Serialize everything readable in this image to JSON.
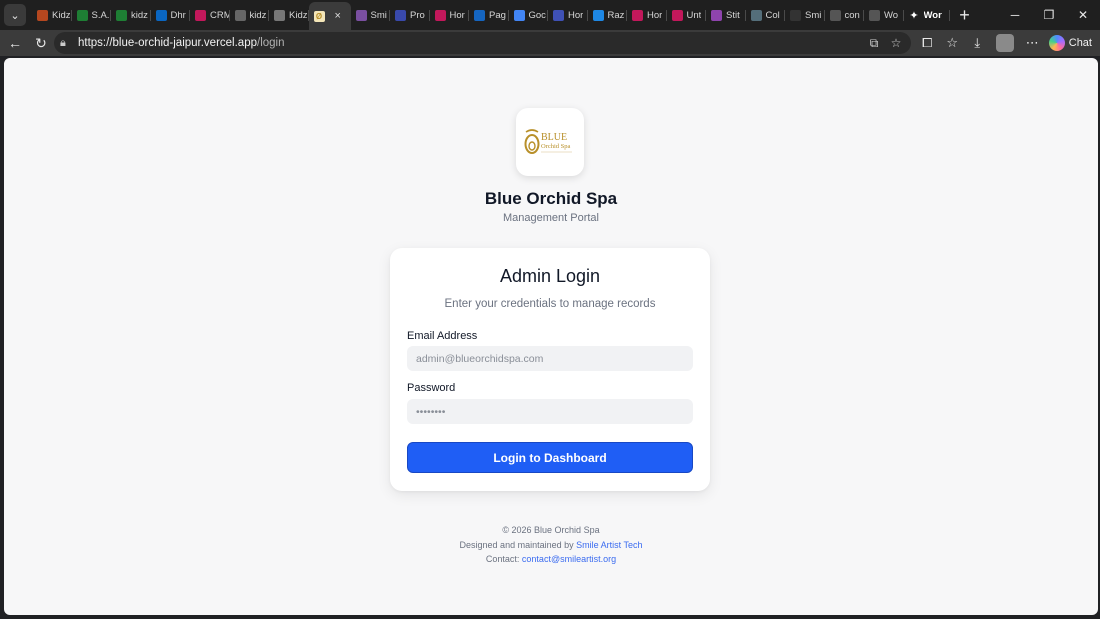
{
  "browser": {
    "tabs": [
      {
        "label": "Kidz",
        "fav_color": "#b5471f"
      },
      {
        "label": "S.A.",
        "fav_color": "#1e7e34"
      },
      {
        "label": "kidz",
        "fav_color": "#1e7e34"
      },
      {
        "label": "Dhr",
        "fav_color": "#0a66c2"
      },
      {
        "label": "CRM",
        "fav_color": "#c2185b"
      },
      {
        "label": "kidz",
        "fav_color": "#666666"
      },
      {
        "label": "Kidz",
        "fav_color": "#777777"
      },
      {
        "label": "Smi",
        "fav_color": "#7a4fa0"
      },
      {
        "label": "Pro",
        "fav_color": "#3949ab"
      },
      {
        "label": "Hor",
        "fav_color": "#c2185b"
      },
      {
        "label": "Pag",
        "fav_color": "#1565c0"
      },
      {
        "label": "Goc",
        "fav_color": "#4285f4"
      },
      {
        "label": "Hor",
        "fav_color": "#3f51b5"
      },
      {
        "label": "Raz",
        "fav_color": "#1e88e5"
      },
      {
        "label": "Hor",
        "fav_color": "#c2185b"
      },
      {
        "label": "Unt",
        "fav_color": "#c2185b"
      },
      {
        "label": "Stit",
        "fav_color": "#8e44ad"
      },
      {
        "label": "Col",
        "fav_color": "#546e7a"
      },
      {
        "label": "Smi",
        "fav_color": "#333333"
      },
      {
        "label": "con",
        "fav_color": "#555555"
      },
      {
        "label": "Wo",
        "fav_color": "#555555"
      }
    ],
    "active_tab": {
      "close_icon": "×"
    },
    "last_tab": {
      "label": "Wor"
    },
    "url_host": "https://blue-orchid-jaipur.vercel.app",
    "url_path": "/login",
    "chat_label": "Chat"
  },
  "brand": {
    "logo_text": "BLUE",
    "logo_subtext": "Orchid Spa",
    "title": "Blue Orchid Spa",
    "subtitle": "Management Portal",
    "logo_color": "#b8902a"
  },
  "login": {
    "title": "Admin Login",
    "subtitle": "Enter your credentials to manage records",
    "email_label": "Email Address",
    "email_placeholder": "admin@blueorchidspa.com",
    "password_label": "Password",
    "password_placeholder": "••••••••",
    "submit_label": "Login to Dashboard",
    "accent": "#1f5ef5"
  },
  "footer": {
    "copyright": "© 2026 Blue Orchid Spa",
    "designed_prefix": "Designed and maintained by ",
    "designed_link": "Smile Artist Tech",
    "contact_prefix": "Contact: ",
    "contact_link": "contact@smileartist.org"
  }
}
